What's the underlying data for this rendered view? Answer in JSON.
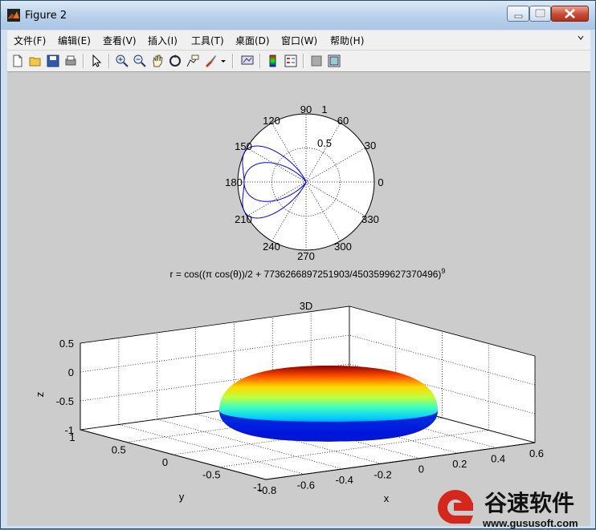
{
  "window": {
    "title": "Figure 2",
    "menu": [
      "文件(F)",
      "编辑(E)",
      "查看(V)",
      "插入(I)",
      "工具(T)",
      "桌面(D)",
      "窗口(W)",
      "帮助(H)"
    ],
    "menu_overflow_icon": "chevron-icon"
  },
  "toolbar": {
    "icons": [
      "new-figure-icon",
      "open-file-icon",
      "save-icon",
      "print-icon",
      "pointer-icon",
      "zoom-in-icon",
      "zoom-out-icon",
      "pan-icon",
      "rotate-3d-icon",
      "data-cursor-icon",
      "brush-icon",
      "link-plot-icon",
      "colorbar-icon",
      "legend-icon",
      "hide-plot-tools-icon",
      "show-plot-tools-icon"
    ]
  },
  "polar_plot": {
    "angle_labels": [
      "90",
      "60",
      "30",
      "0",
      "330",
      "300",
      "270",
      "240",
      "210",
      "180",
      "150",
      "120"
    ],
    "radial_labels": [
      "0.5",
      "1"
    ],
    "xlabel": "r = cos((π cos(θ))/2 + 7736266897251903/4503599627370496)",
    "xlabel_exponent": "9",
    "line_color": "#0000ff"
  },
  "surface_plot": {
    "title": "3D",
    "xlabel": "x",
    "ylabel": "y",
    "zlabel": "z",
    "x_ticks": [
      "-0.8",
      "-0.6",
      "-0.4",
      "-0.2",
      "0",
      "0.2",
      "0.4",
      "0.6"
    ],
    "y_ticks": [
      "-1",
      "-0.5",
      "0",
      "0.5",
      "1"
    ],
    "z_ticks": [
      "0.5",
      "0",
      "-0.5",
      "-1"
    ],
    "colormap": "jet"
  },
  "watermark": {
    "brand": "谷速软件",
    "url": "www.gususoft.com"
  }
}
